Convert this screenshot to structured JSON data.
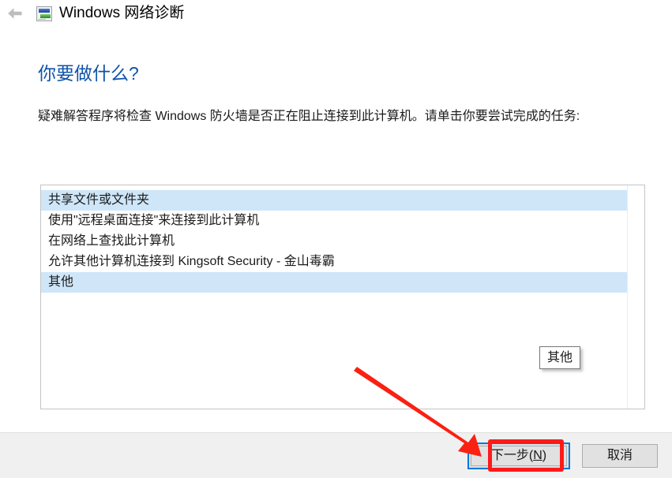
{
  "window": {
    "title": "Windows 网络诊断",
    "back_icon": "back-arrow-icon",
    "app_icon": "network-diagnostics-icon"
  },
  "main": {
    "heading": "你要做什么?",
    "body_text": "疑难解答程序将检查 Windows 防火墙是否正在阻止连接到此计算机。请单击你要尝试完成的任务:",
    "list": {
      "items": [
        {
          "label": "共享文件或文件夹",
          "selected": true
        },
        {
          "label": "使用\"远程桌面连接\"来连接到此计算机",
          "selected": false
        },
        {
          "label": "在网络上查找此计算机",
          "selected": false
        },
        {
          "label": "允许其他计算机连接到 Kingsoft Security - 金山毒霸",
          "selected": false
        },
        {
          "label": "其他",
          "selected": true
        }
      ]
    },
    "tooltip": {
      "text": "其他"
    }
  },
  "footer": {
    "next_label_prefix": "下一步(",
    "next_accel": "N",
    "next_label_suffix": ")",
    "cancel_label": "取消"
  },
  "annotations": {
    "highlight_color": "#ff1a1a",
    "focus_color": "#0078d7",
    "selection_color": "#cfe6f9",
    "heading_color": "#0f53a8"
  }
}
